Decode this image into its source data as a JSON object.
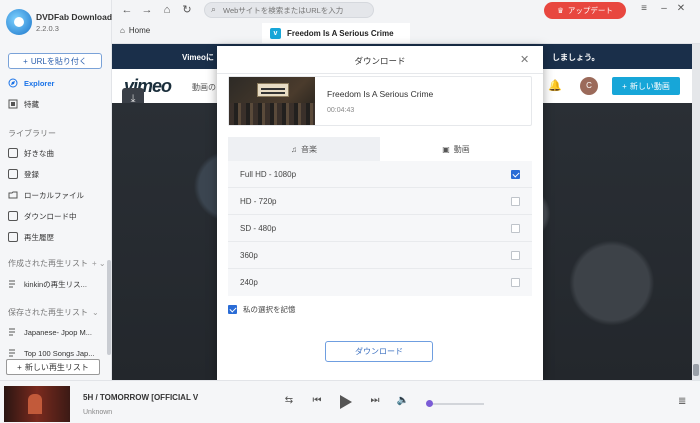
{
  "app": {
    "name": "DVDFab Downloader",
    "version": "2.2.0.3"
  },
  "sidebar": {
    "paste_url": "URLを貼り付く",
    "nav": [
      {
        "label": "Explorer"
      },
      {
        "label": "特藏"
      }
    ],
    "library_heading": "ライブラリー",
    "library": [
      {
        "label": "好きな曲"
      },
      {
        "label": "登録"
      },
      {
        "label": "ローカルファイル"
      },
      {
        "label": "ダウンロード中"
      },
      {
        "label": "再生履歴"
      }
    ],
    "created_heading": "作成された再生リスト",
    "created": [
      {
        "label": "kinkinの再生リス..."
      }
    ],
    "saved_heading": "保存された再生リスト",
    "saved": [
      {
        "label": "Japanese- Jpop M..."
      },
      {
        "label": "Top 100 Songs Jap..."
      }
    ],
    "new_playlist": "新しい再生リスト"
  },
  "topbar": {
    "search_placeholder": "Webサイトを検索またはURLを入力",
    "upgrade": "アップデート"
  },
  "tabs": {
    "home": "Home",
    "active": "Freedom Is A Serious Crime"
  },
  "page": {
    "banner_left": "Vimeoに",
    "banner_right": "しましょう。",
    "header_text": "動画の",
    "avatar_letter": "C",
    "new_video": "新しい動画"
  },
  "modal": {
    "title": "ダウンロード",
    "media_title": "Freedom Is A Serious Crime",
    "duration": "00:04:43",
    "tab_music": "音楽",
    "tab_video": "動画",
    "qualities": [
      {
        "label": "Full HD - 1080p",
        "checked": true
      },
      {
        "label": "HD - 720p",
        "checked": false
      },
      {
        "label": "SD - 480p",
        "checked": false
      },
      {
        "label": "360p",
        "checked": false
      },
      {
        "label": "240p",
        "checked": false
      }
    ],
    "remember": "私の選択を記憶",
    "download_button": "ダウンロード"
  },
  "player": {
    "track_title": "5H / TOMORROW [OFFICIAL V",
    "artist": "Unknown"
  },
  "colors": {
    "accent": "#1a73e8",
    "upgrade": "#e8473f",
    "vimeo": "#17a6d8",
    "checkbox": "#2a6cd6"
  }
}
